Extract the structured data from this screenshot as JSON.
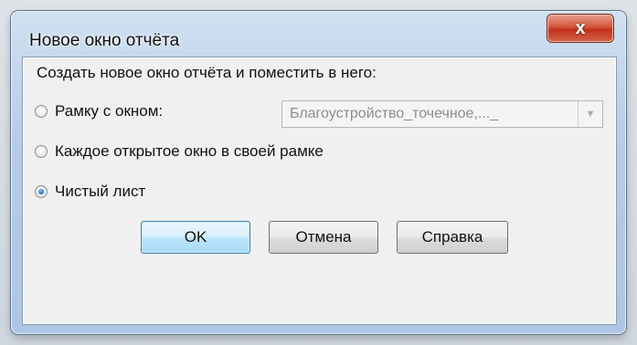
{
  "dialog": {
    "title": "Новое окно отчёта",
    "close_label": "x"
  },
  "content": {
    "prompt": "Создать новое окно отчёта и поместить в него:",
    "options": [
      {
        "label": "Рамку с окном:",
        "checked": false
      },
      {
        "label": "Каждое открытое окно в своей рамке",
        "checked": false
      },
      {
        "label": "Чистый лист",
        "checked": true
      }
    ],
    "frame_select": {
      "value": "Благоустройство_точечное,..._"
    }
  },
  "buttons": {
    "ok": "OK",
    "cancel": "Отмена",
    "help": "Справка"
  },
  "colors": {
    "accent": "#3c7fb1",
    "close_red": "#c2301a"
  },
  "icons": {
    "close": "close-icon",
    "dropdown": "chevron-down-icon"
  }
}
